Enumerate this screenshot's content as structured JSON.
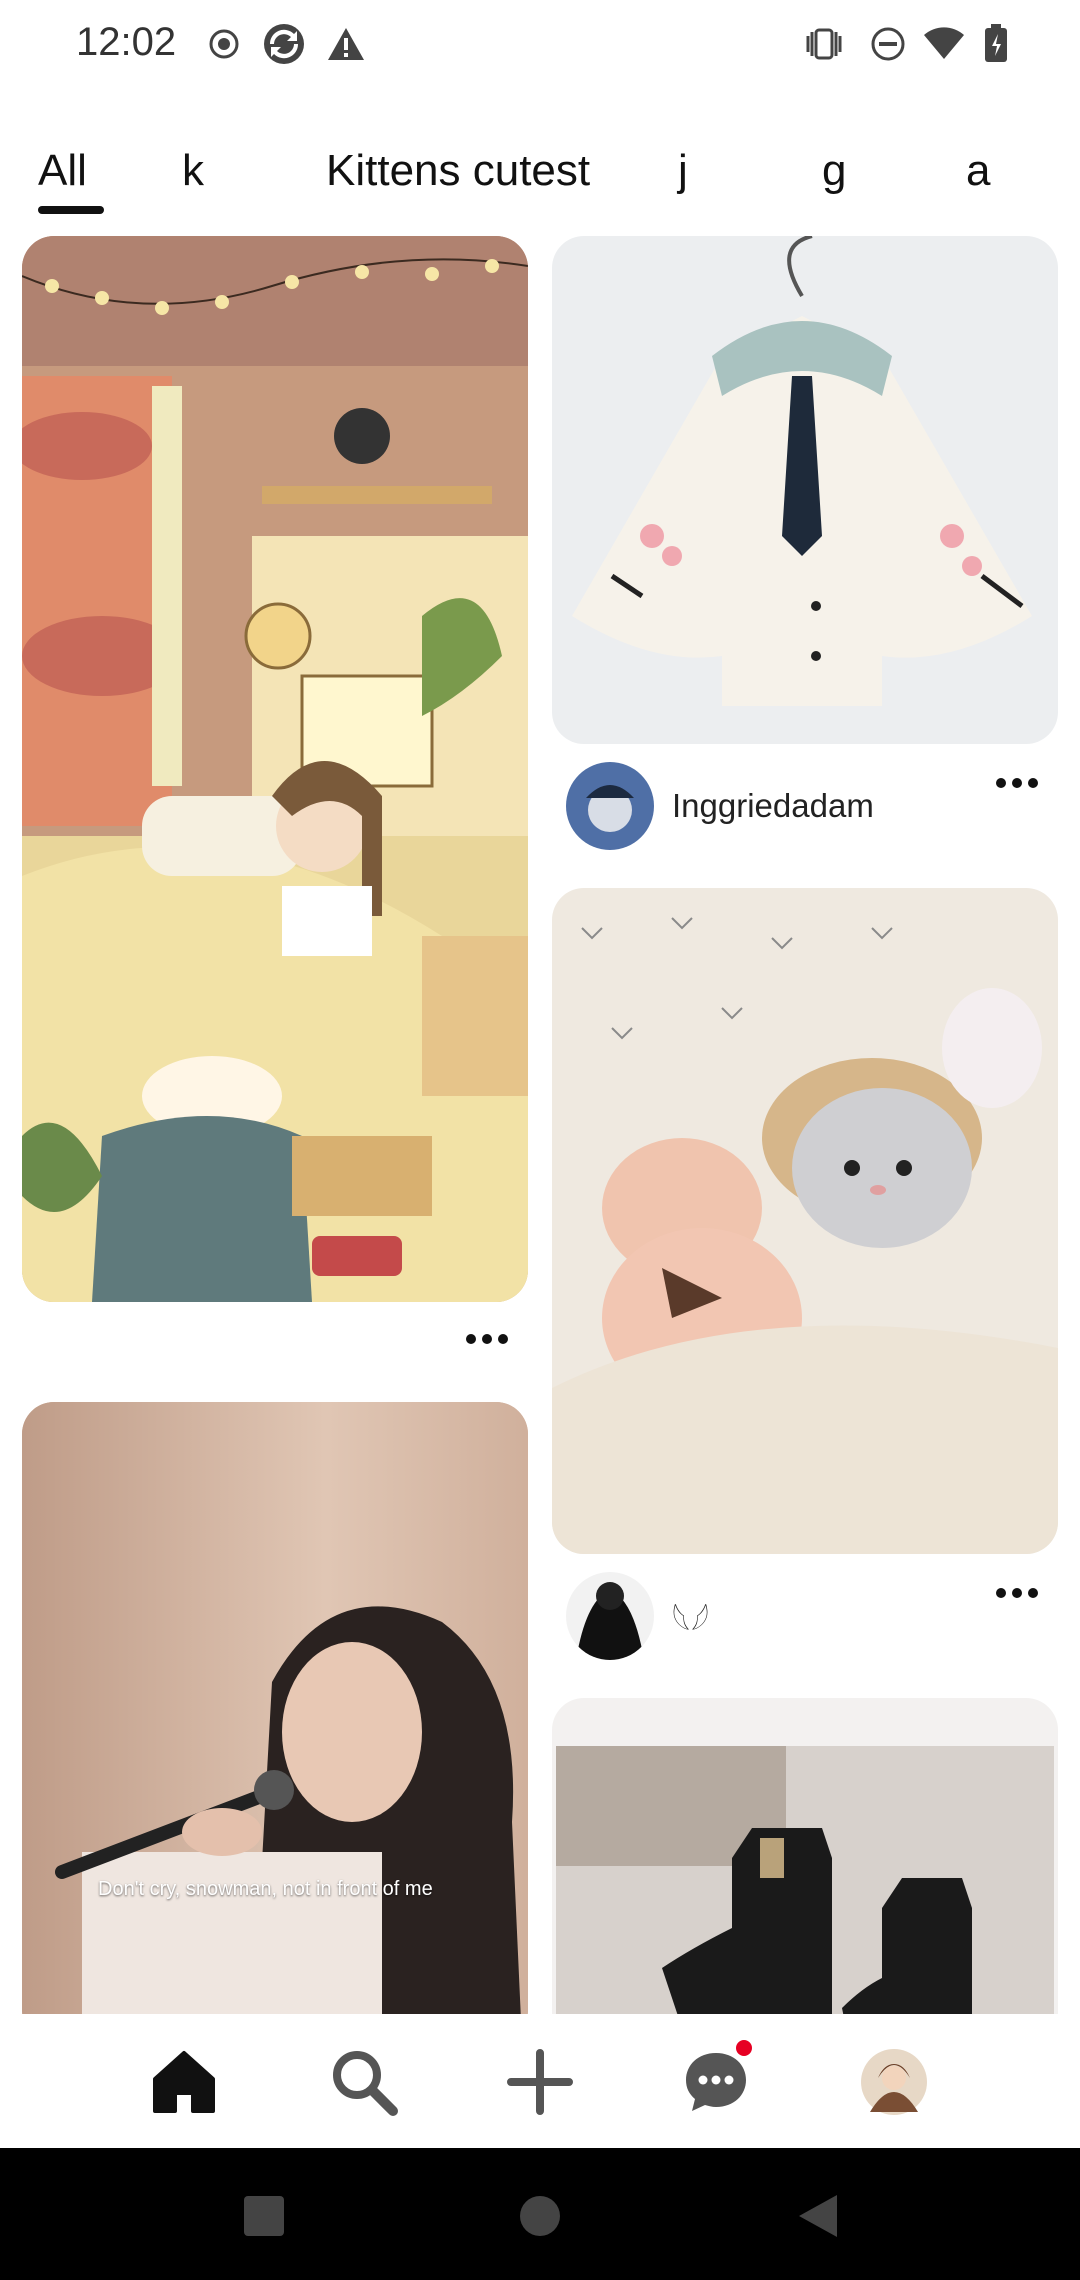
{
  "status_bar": {
    "time": "12:02"
  },
  "tabs": [
    {
      "label": "All",
      "active": true
    },
    {
      "label": "k",
      "active": false
    },
    {
      "label": "Kittens cutest",
      "active": false
    },
    {
      "label": "j",
      "active": false
    },
    {
      "label": "g",
      "active": false
    },
    {
      "label": "a",
      "active": false
    }
  ],
  "feed": {
    "pins": [
      {
        "image": "illustrated bedroom with girl and cat",
        "author": ""
      },
      {
        "image": "white hooded cape jacket with tie",
        "author": "Inggriedadam"
      },
      {
        "image": "kitten with teddy bear in bed",
        "author": "𓆩𓆪"
      },
      {
        "image": "woman singing into microphone",
        "caption": "Don't cry, snowman, not in front of me"
      },
      {
        "image": "black chelsea boots",
        "author": ""
      }
    ]
  },
  "bottom_nav": {
    "items": [
      {
        "name": "home",
        "active": true
      },
      {
        "name": "search"
      },
      {
        "name": "create"
      },
      {
        "name": "messages",
        "has_notification": true
      },
      {
        "name": "profile"
      }
    ],
    "notification_color": "#e60023"
  }
}
